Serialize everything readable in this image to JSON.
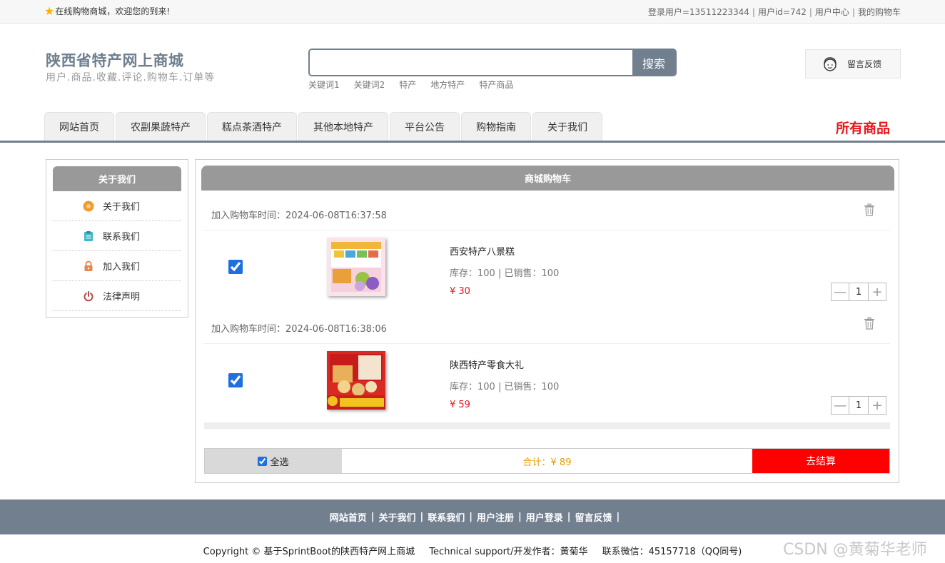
{
  "topbar": {
    "welcome": "在线购物商城，欢迎您的到来!",
    "links": [
      "登录用户=13511223344",
      "用户id=742",
      "用户中心",
      "我的购物车"
    ]
  },
  "header": {
    "title": "陕西省特产网上商城",
    "subtitle": "用户.商品.收藏.评论.购物车.订单等",
    "search": {
      "value": "",
      "placeholder": "",
      "button": "搜索"
    },
    "keywords": [
      "关键词1",
      "关键词2",
      "特产",
      "地方特产",
      "特产商品"
    ],
    "feedback": "留言反馈"
  },
  "nav": {
    "tabs": [
      "网站首页",
      "农副果蔬特产",
      "糕点茶酒特产",
      "其他本地特产",
      "平台公告",
      "购物指南",
      "关于我们"
    ],
    "all_goods": "所有商品"
  },
  "sidebar": {
    "title": "关于我们",
    "items": [
      {
        "label": "关于我们",
        "icon": "orange-circle-icon",
        "color": "#f39a2b"
      },
      {
        "label": "联系我们",
        "icon": "clipboard-icon",
        "color": "#3fb8c9"
      },
      {
        "label": "加入我们",
        "icon": "lock-icon",
        "color": "#e8864a"
      },
      {
        "label": "法律声明",
        "icon": "power-icon",
        "color": "#b44a4a"
      }
    ]
  },
  "cart": {
    "title": "商城购物车",
    "items": [
      {
        "time": "加入购物车时间：2024-06-08T16:37:58",
        "name": "西安特产八景糕",
        "stock": "库存：100 | 已销售：100",
        "price": "¥ 30",
        "qty": "1",
        "checked": true
      },
      {
        "time": "加入购物车时间：2024-06-08T16:38:06",
        "name": "陕西特产零食大礼",
        "stock": "库存：100 | 已销售：100",
        "price": "¥ 59",
        "qty": "1",
        "checked": true
      }
    ],
    "select_all": "全选",
    "total": "合计：¥ 89",
    "checkout": "去结算"
  },
  "footer": {
    "links": [
      "网站首页",
      "关于我们",
      "联系我们",
      "用户注册",
      "用户登录",
      "留言反馈"
    ],
    "copyright": "Copyright © 基于SprintBoot的陕西特产网上商城",
    "support": "Technical support/开发作者：黄菊华",
    "contact": "联系微信：45157718（QQ同号)"
  },
  "watermark": "CSDN @黄菊华老师",
  "colors": {
    "accent": "#717f8f",
    "price_red": "#e8161b",
    "checkout_red": "#ff0000",
    "total_orange": "#e59d00"
  }
}
